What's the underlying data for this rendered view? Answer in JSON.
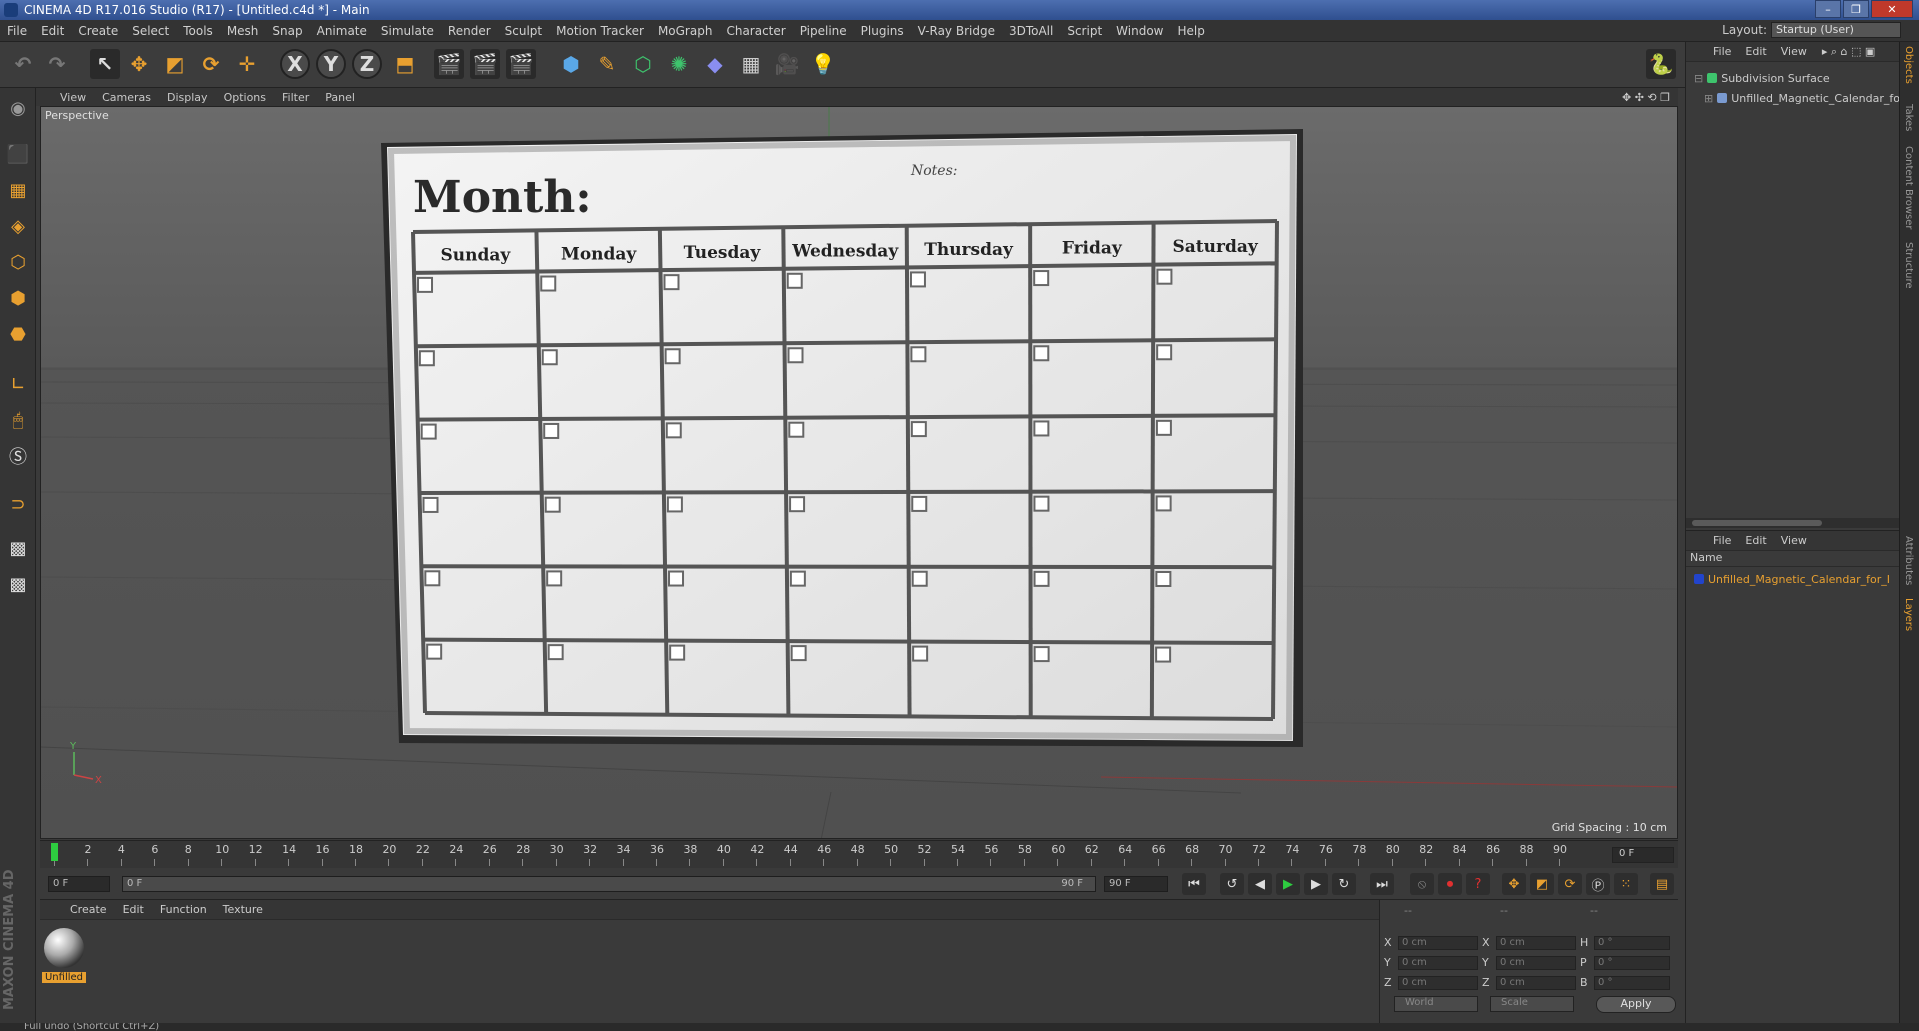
{
  "window": {
    "title": "CINEMA 4D R17.016 Studio (R17) - [Untitled.c4d *] - Main",
    "controls": [
      "–",
      "❐",
      "✕"
    ]
  },
  "menu": [
    "File",
    "Edit",
    "Create",
    "Select",
    "Tools",
    "Mesh",
    "Snap",
    "Animate",
    "Simulate",
    "Render",
    "Sculpt",
    "Motion Tracker",
    "MoGraph",
    "Character",
    "Pipeline",
    "Plugins",
    "V-Ray Bridge",
    "3DToAll",
    "Script",
    "Window",
    "Help"
  ],
  "layout": {
    "label": "Layout:",
    "value": "Startup (User)"
  },
  "toolbar": {
    "axis_x": "X",
    "axis_y": "Y",
    "axis_z": "Z"
  },
  "viewport": {
    "menu": [
      "View",
      "Cameras",
      "Display",
      "Options",
      "Filter",
      "Panel"
    ],
    "label": "Perspective",
    "grid_spacing": "Grid Spacing : 10 cm",
    "axis_x": "X",
    "axis_y": "Y"
  },
  "calendar": {
    "title": "Month:",
    "notes": "Notes:",
    "days": [
      "Sunday",
      "Monday",
      "Tuesday",
      "Wednesday",
      "Thursday",
      "Friday",
      "Saturday"
    ],
    "weeks": 6
  },
  "timeline": {
    "ticks": [
      "0",
      "2",
      "4",
      "6",
      "8",
      "10",
      "12",
      "14",
      "16",
      "18",
      "20",
      "22",
      "24",
      "26",
      "28",
      "30",
      "32",
      "34",
      "36",
      "38",
      "40",
      "42",
      "44",
      "46",
      "48",
      "50",
      "52",
      "54",
      "56",
      "58",
      "60",
      "62",
      "64",
      "66",
      "68",
      "70",
      "72",
      "74",
      "76",
      "78",
      "80",
      "82",
      "84",
      "86",
      "88",
      "90"
    ],
    "current_frame": "0 F"
  },
  "transport": {
    "start": "0 F",
    "range_start": "0 F",
    "range_end": "90 F",
    "end": "90 F"
  },
  "material_manager": {
    "menu": [
      "Create",
      "Edit",
      "Function",
      "Texture"
    ],
    "material_name": "Unfilled"
  },
  "coordinates": {
    "headers": [
      "--",
      "--",
      "--"
    ],
    "rows": [
      {
        "l1": "X",
        "v1": "0 cm",
        "l2": "X",
        "v2": "0 cm",
        "l3": "H",
        "v3": "0 °"
      },
      {
        "l1": "Y",
        "v1": "0 cm",
        "l2": "Y",
        "v2": "0 cm",
        "l3": "P",
        "v3": "0 °"
      },
      {
        "l1": "Z",
        "v1": "0 cm",
        "l2": "Z",
        "v2": "0 cm",
        "l3": "B",
        "v3": "0 °"
      }
    ],
    "mode1": "World",
    "mode2": "Scale",
    "apply": "Apply"
  },
  "object_manager": {
    "menu": [
      "File",
      "Edit",
      "View"
    ],
    "objects": [
      "Subdivision Surface",
      "Unfilled_Magnetic_Calendar_for_"
    ]
  },
  "layer_manager": {
    "menu": [
      "File",
      "Edit",
      "View"
    ],
    "header": "Name",
    "layers": [
      "Unfilled_Magnetic_Calendar_for_I"
    ]
  },
  "side_tabs": [
    "Objects",
    "Takes",
    "Content Browser",
    "Structure",
    "Attributes",
    "Layers"
  ],
  "status": "Full undo (Shortcut Ctrl+Z)",
  "brand": "MAXON CINEMA 4D",
  "colors": {
    "accent": "#e8a030",
    "play": "#2ecc40",
    "record": "#e03030"
  }
}
